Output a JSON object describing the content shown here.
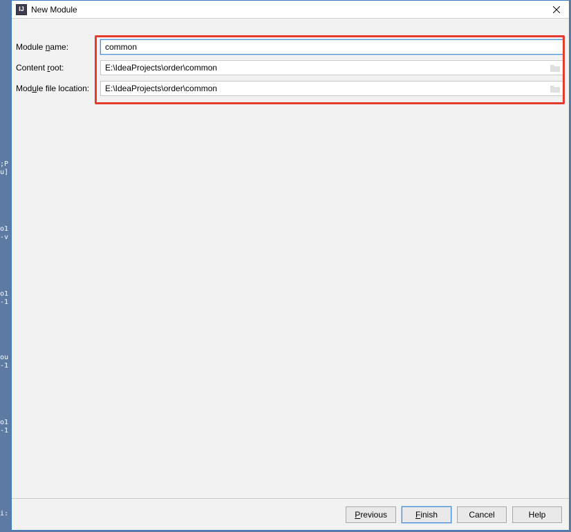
{
  "window": {
    "title": "New Module",
    "icon_label": "IJ"
  },
  "form": {
    "module_name": {
      "label_pre": "Module ",
      "label_mnemonic": "n",
      "label_post": "ame:",
      "value": "common"
    },
    "content_root": {
      "label_pre": "Content ",
      "label_mnemonic": "r",
      "label_post": "oot:",
      "value": "E:\\IdeaProjects\\order\\common"
    },
    "module_file_location": {
      "label_pre": "Mod",
      "label_mnemonic": "u",
      "label_post": "le file location:",
      "value": "E:\\IdeaProjects\\order\\common"
    }
  },
  "buttons": {
    "previous": {
      "mnemonic": "P",
      "rest": "revious"
    },
    "finish": {
      "mnemonic": "F",
      "rest": "inish"
    },
    "cancel": {
      "text": "Cancel"
    },
    "help": {
      "text": "Help"
    }
  },
  "side_noise": {
    "n1": ";P",
    "n2": "u]",
    "n3": "o1",
    "n4": "-v",
    "n5": "o1",
    "n6": "-1",
    "n7": "ou",
    "n8": "-1",
    "n9": "o1",
    "n10": "-1",
    "n11": "i:"
  }
}
